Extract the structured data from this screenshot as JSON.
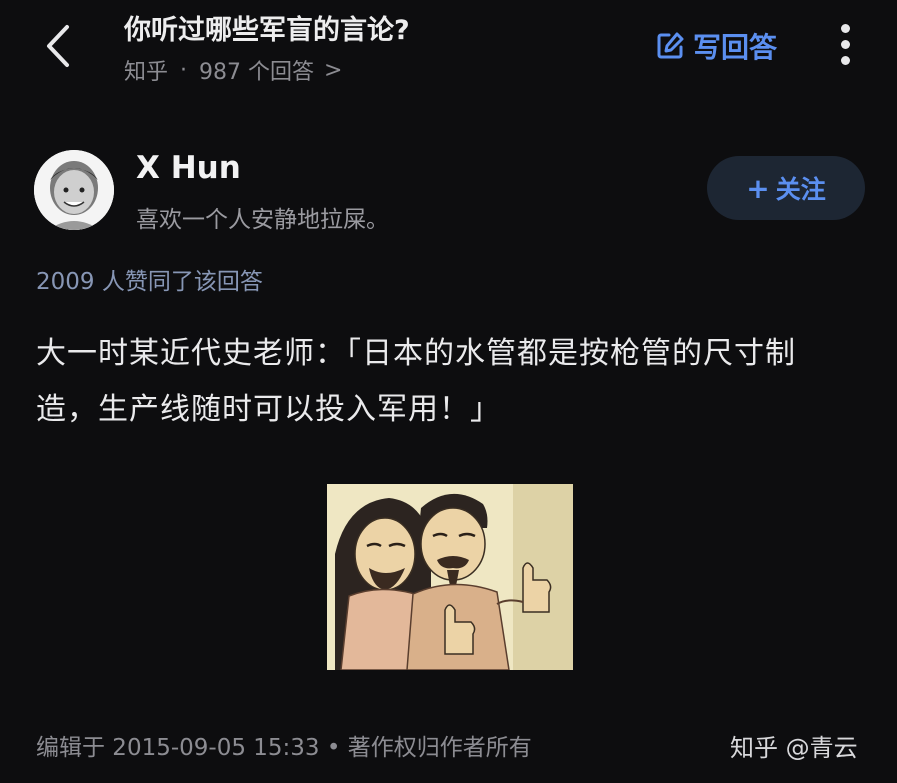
{
  "header": {
    "title": "你听过哪些军盲的言论?",
    "source": "知乎",
    "separator": "·",
    "answer_count": "987 个回答",
    "chevron": ">",
    "write_answer_label": "写回答",
    "back_icon": "chevron-left-icon",
    "write_icon": "edit-icon",
    "more_icon": "more-vertical-icon"
  },
  "author": {
    "name": "X Hun",
    "bio": "喜欢一个人安静地拉屎。",
    "follow_label": "关注",
    "follow_plus": "+"
  },
  "answer": {
    "upvote_text": "2009 人赞同了该回答",
    "content": "大一时某近代史老师：「日本的水管都是按枪管的尺寸制造，生产线随时可以投入军用！」",
    "footer": "编辑于 2015-09-05 15:33 • 著作权归作者所有"
  },
  "watermark": "知乎 @青云",
  "colors": {
    "background": "#0d0d0f",
    "accent": "#5b8ff0",
    "upvote": "#8796b5",
    "follow_bg": "#1d2633"
  }
}
